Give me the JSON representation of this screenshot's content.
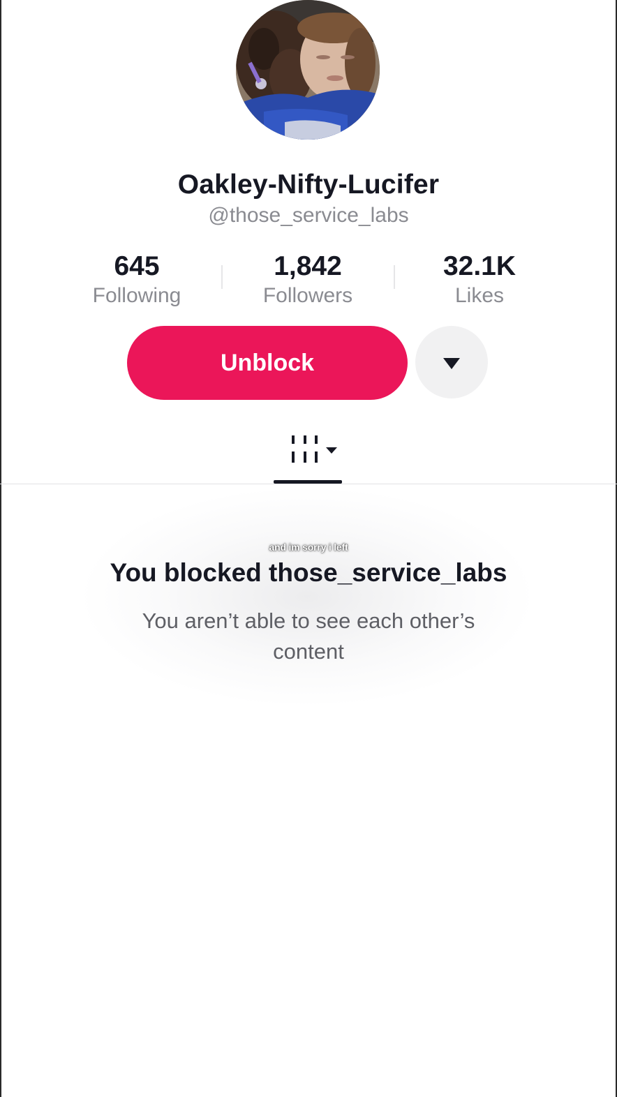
{
  "profile": {
    "display_name": "Oakley-Nifty-Lucifer",
    "handle": "@those_service_labs"
  },
  "stats": [
    {
      "value": "645",
      "label": "Following"
    },
    {
      "value": "1,842",
      "label": "Followers"
    },
    {
      "value": "32.1K",
      "label": "Likes"
    }
  ],
  "actions": {
    "unblock_label": "Unblock",
    "more_icon": "caret-down-icon"
  },
  "tabs": {
    "active": "videos",
    "videos_icon": "grid-with-caret-icon"
  },
  "caption_overlay": "and im sorry i left",
  "blocked_notice": {
    "title": "You blocked those_service_labs",
    "subtitle": "You aren’t able to see each other’s content"
  },
  "colors": {
    "accent": "#eb1659",
    "text_primary": "#161823",
    "text_secondary": "#8a8b91"
  }
}
